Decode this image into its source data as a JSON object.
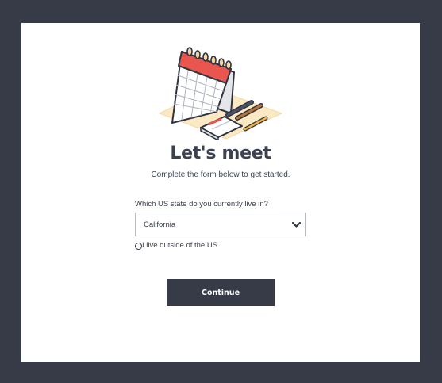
{
  "heading": {
    "title": "Let's meet",
    "subtitle": "Complete the form below to get started."
  },
  "form": {
    "question": "Which US state do you currently live in?",
    "state_select": {
      "value": "California"
    },
    "outside_us_option": {
      "label": "I live outside of the US",
      "checked": false
    },
    "continue_label": "Continue"
  },
  "illustration": {
    "icon": "calendar-desk-icon"
  },
  "colors": {
    "frame": "#373b47",
    "card": "#ffffff",
    "text": "#3b4150",
    "button": "#373b47",
    "calendar_red": "#e8564f",
    "desk_mat": "#fbe9c4"
  }
}
